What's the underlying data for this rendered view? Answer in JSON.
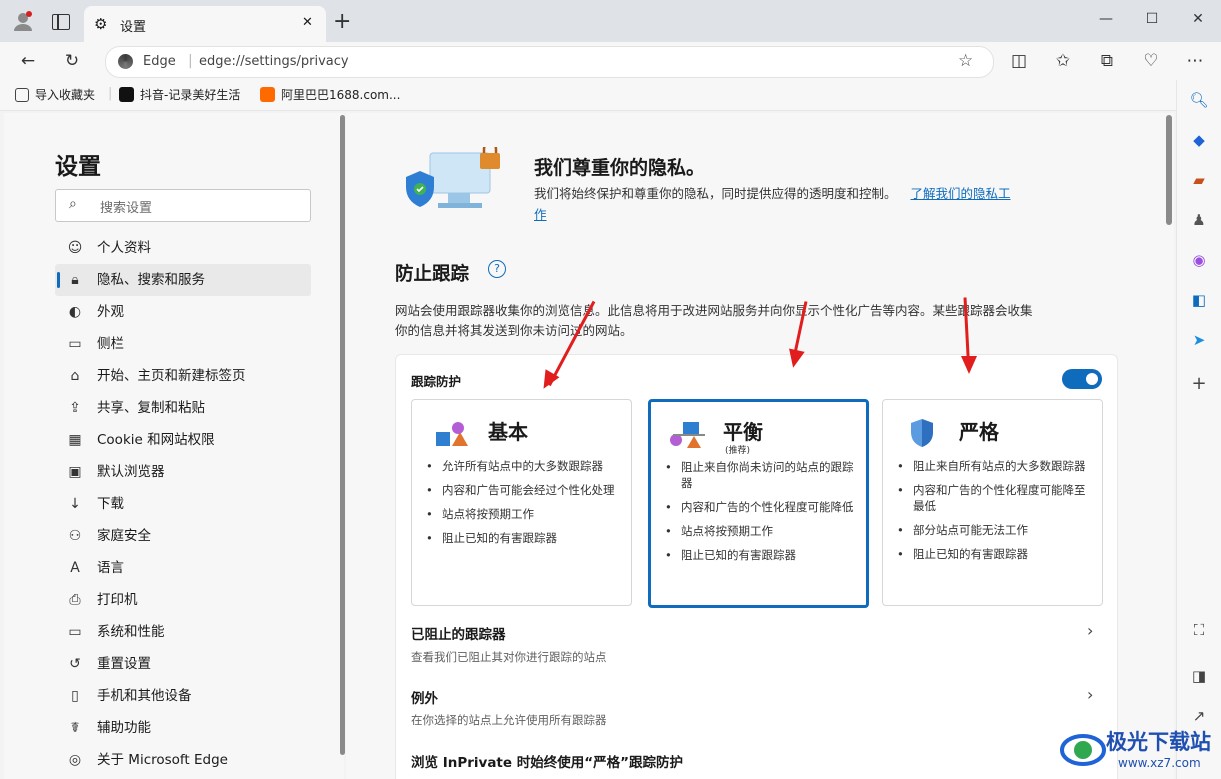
{
  "window": {
    "tab_title": "设置",
    "new_tab": "+",
    "minimize": "—",
    "maximize": "☐",
    "close": "✕"
  },
  "addressbar": {
    "site_label": "Edge",
    "url": "edge://settings/privacy"
  },
  "bookmarks": [
    {
      "label": "导入收藏夹"
    },
    {
      "label": "抖音-记录美好生活"
    },
    {
      "label": "阿里巴巴1688.com..."
    }
  ],
  "sidebar": {
    "title": "设置",
    "search_placeholder": "搜索设置",
    "items": [
      {
        "label": "个人资料",
        "icon": "person-icon"
      },
      {
        "label": "隐私、搜索和服务",
        "icon": "lock-icon"
      },
      {
        "label": "外观",
        "icon": "palette-icon"
      },
      {
        "label": "侧栏",
        "icon": "sidebar-icon"
      },
      {
        "label": "开始、主页和新建标签页",
        "icon": "home-icon"
      },
      {
        "label": "共享、复制和粘贴",
        "icon": "share-icon"
      },
      {
        "label": "Cookie 和网站权限",
        "icon": "cookie-icon"
      },
      {
        "label": "默认浏览器",
        "icon": "browser-icon"
      },
      {
        "label": "下载",
        "icon": "download-icon"
      },
      {
        "label": "家庭安全",
        "icon": "family-icon"
      },
      {
        "label": "语言",
        "icon": "language-icon"
      },
      {
        "label": "打印机",
        "icon": "printer-icon"
      },
      {
        "label": "系统和性能",
        "icon": "laptop-icon"
      },
      {
        "label": "重置设置",
        "icon": "reset-icon"
      },
      {
        "label": "手机和其他设备",
        "icon": "phone-icon"
      },
      {
        "label": "辅助功能",
        "icon": "accessibility-icon"
      },
      {
        "label": "关于 Microsoft Edge",
        "icon": "edge-icon"
      }
    ]
  },
  "privacy_header": {
    "title": "我们尊重你的隐私。",
    "description": "我们将始终保护和尊重你的隐私，同时提供应得的透明度和控制。",
    "link_line1": "了解我们的隐私工",
    "link_line2": "作"
  },
  "tracking": {
    "section_title": "防止跟踪",
    "description_line1": "网站会使用跟踪器收集你的浏览信息。此信息将用于改进网站服务并向你显示个性化广告等内容。某些跟踪器会收集",
    "description_line2": "你的信息并将其发送到你未访问过的网站。",
    "toggle_label": "跟踪防护",
    "toggle_on": true,
    "modes": [
      {
        "title": "基本",
        "subtitle": "",
        "selected": false,
        "bullets": [
          "允许所有站点中的大多数跟踪器",
          "内容和广告可能会经过个性化处理",
          "站点将按预期工作",
          "阻止已知的有害跟踪器"
        ]
      },
      {
        "title": "平衡",
        "subtitle": "(推荐)",
        "selected": true,
        "bullets": [
          "阻止来自你尚未访问的站点的跟踪器",
          "内容和广告的个性化程度可能降低",
          "站点将按预期工作",
          "阻止已知的有害跟踪器"
        ]
      },
      {
        "title": "严格",
        "subtitle": "",
        "selected": false,
        "bullets": [
          "阻止来自所有站点的大多数跟踪器",
          "内容和广告的个性化程度可能降至最低",
          "部分站点可能无法工作",
          "阻止已知的有害跟踪器"
        ]
      }
    ],
    "blocked": {
      "title": "已阻止的跟踪器",
      "subtitle": "查看我们已阻止其对你进行跟踪的站点"
    },
    "exceptions": {
      "title": "例外",
      "subtitle": "在你选择的站点上允许使用所有跟踪器"
    },
    "inprivate": {
      "title": "浏览 InPrivate 时始终使用“严格”跟踪防护"
    }
  },
  "watermark": {
    "text": "极光下载站",
    "url": "www.xz7.com"
  },
  "colors": {
    "accent": "#0f6cbd",
    "arrow": "#e11d1d"
  }
}
